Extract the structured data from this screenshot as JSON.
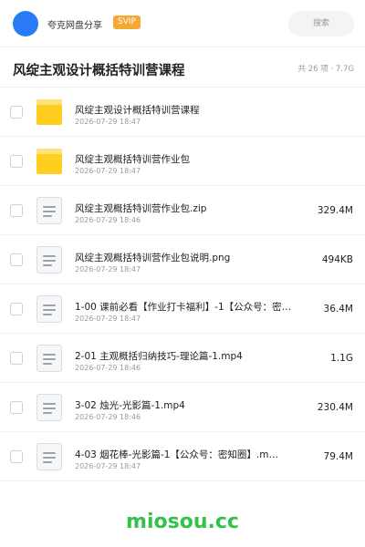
{
  "header": {
    "share_name": "夸克网盘分享",
    "badge": "SVIP",
    "search_label": "搜索",
    "avatar_color": "#2a7bf6"
  },
  "folder": {
    "title": "风绽主观设计概括特训营课程",
    "count": "共 26 项",
    "separator": "·",
    "total_size": "7.7G"
  },
  "items": [
    {
      "type": "folder",
      "icon": "folder-icon",
      "name": "风绽主观设计概括特训营课程",
      "date": "2026-07-29 18:47",
      "size": ""
    },
    {
      "type": "folder",
      "icon": "folder-icon",
      "name": "风绽主观概括特训营作业包",
      "date": "2026-07-29 18:47",
      "size": ""
    },
    {
      "type": "file",
      "icon": "file-icon",
      "name": "风绽主观概括特训营作业包.zip",
      "date": "2026-07-29 18:46",
      "size": "329.4M"
    },
    {
      "type": "file",
      "icon": "file-icon",
      "name": "风绽主观概括特训营作业包说明.png",
      "date": "2026-07-29 18:47",
      "size": "494KB"
    },
    {
      "type": "file",
      "icon": "file-icon",
      "name": "1-00 课前必看【作业打卡福利】-1【公众号：密…",
      "date": "2026-07-29 18:47",
      "size": "36.4M"
    },
    {
      "type": "file",
      "icon": "file-icon",
      "name": "2-01 主观概括归纳技巧-理论篇-1.mp4",
      "date": "2026-07-29 18:46",
      "size": "1.1G"
    },
    {
      "type": "file",
      "icon": "file-icon",
      "name": "3-02 烛光-光影篇-1.mp4",
      "date": "2026-07-29 18:46",
      "size": "230.4M"
    },
    {
      "type": "file",
      "icon": "file-icon",
      "name": "4-03 烟花棒-光影篇-1【公众号：密知圈】.m…",
      "date": "2026-07-29 18:47",
      "size": "79.4M"
    }
  ],
  "watermark": "miosou.cc"
}
